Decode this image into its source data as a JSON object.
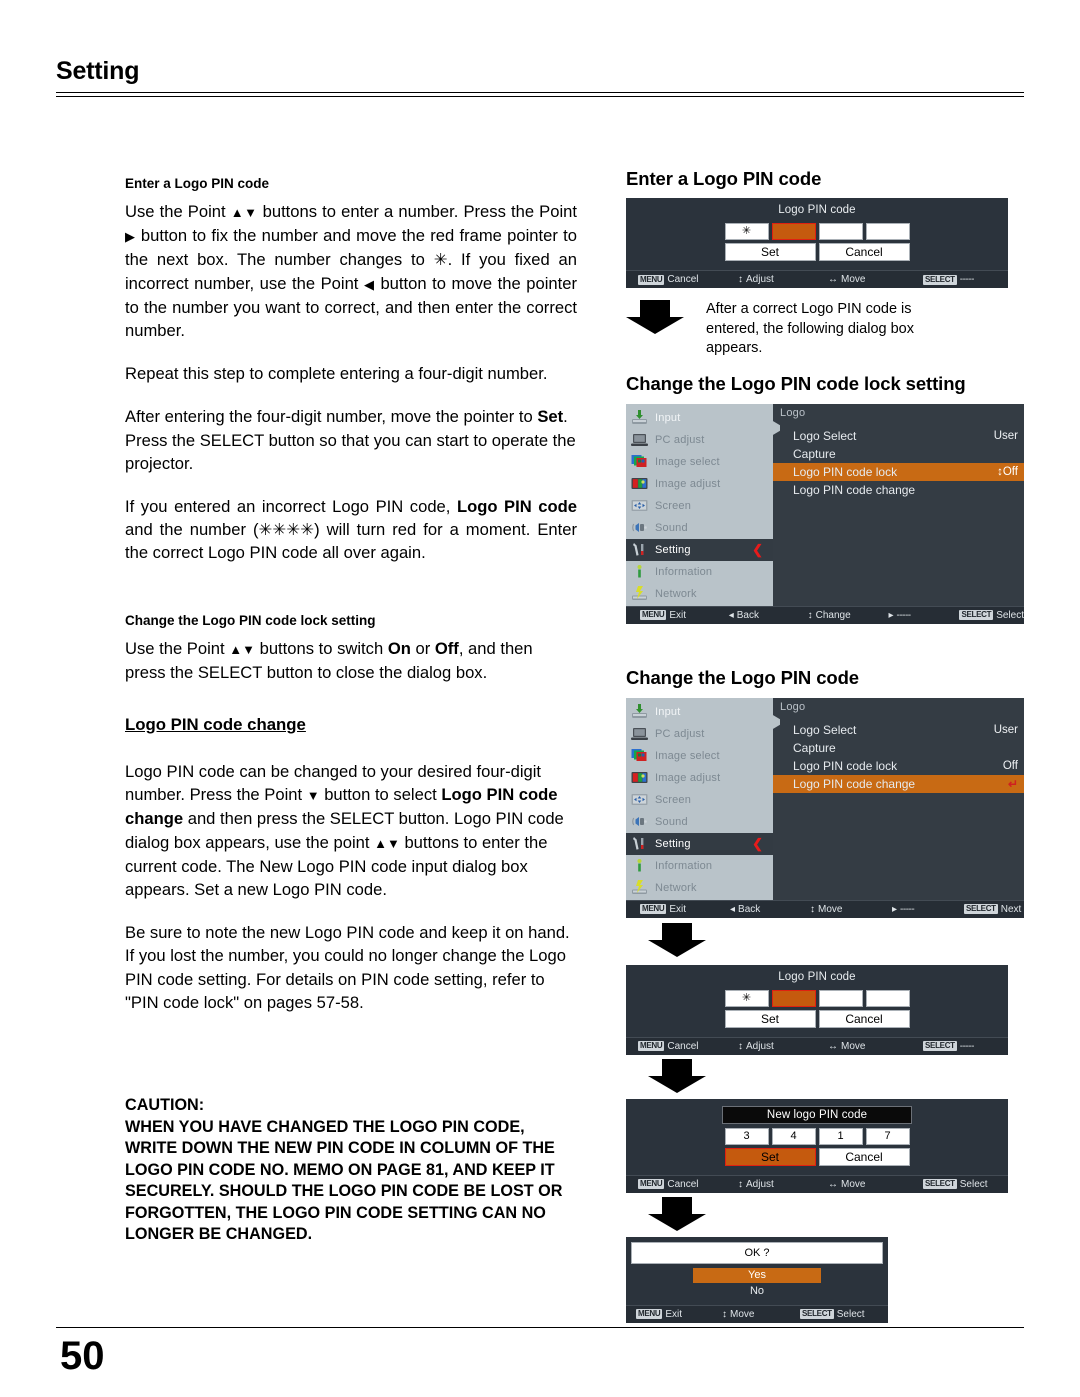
{
  "header": {
    "chapter": "Setting"
  },
  "footer": {
    "page_number": "50"
  },
  "left": {
    "section1_heading": "Enter a Logo PIN code",
    "p1_a": "Use the Point ",
    "p1_up": "▲",
    "p1_dn": "▼",
    "p1_b": " buttons to enter a number. Press the Point ",
    "p1_right": "▶",
    "p1_c": " button to fix the number and move the red frame pointer to the next box. The number changes to ",
    "p1_star": "✳",
    "p1_d": ". If you fixed an incorrect number, use the Point ",
    "p1_left": "◀",
    "p1_e": " button to move the pointer to the number you want to correct, and then enter the correct number.",
    "p2": "Repeat this step to complete entering a four-digit number.",
    "p3_a": "After entering the four-digit number, move the pointer to ",
    "p3_set": "Set",
    "p3_b": ". Press the SELECT button so that you can start to operate the projector.",
    "p4_a": "If you entered an incorrect Logo PIN code, ",
    "p4_bold": "Logo PIN code",
    "p4_b": " and the number (",
    "p4_stars": "✳✳✳✳",
    "p4_c": ") will turn red for a moment. Enter the correct Logo PIN code all over again.",
    "section2_heading": "Change the Logo PIN code lock setting",
    "p5_a": "Use the Point ",
    "p5_b": " buttons to switch ",
    "p5_on": "On",
    "p5_or": " or ",
    "p5_off": "Off",
    "p5_c": ", and then press the SELECT button to close the dialog box.",
    "section3_heading": "Logo PIN code change",
    "p6_a": "Logo PIN code can be changed to your desired four-digit number. Press the Point ",
    "p6_dn": "▼",
    "p6_b": " button to select ",
    "p6_bold": "Logo PIN code change",
    "p6_c": " and then press the SELECT button. Logo PIN code dialog box appears, use the point ",
    "p6_d": " buttons to enter the current code. The New Logo PIN code input dialog box appears. Set a new Logo PIN code.",
    "p7": "Be sure to note the new Logo PIN code and keep it on hand. If you lost the number, you could no longer change the Logo PIN code setting. For details on PIN code setting, refer to \"PIN code lock\" on pages 57-58.",
    "caution_title": "CAUTION:",
    "caution_body": "WHEN YOU HAVE CHANGED THE LOGO PIN CODE, WRITE DOWN THE NEW PIN CODE IN COLUMN OF THE LOGO PIN CODE NO. MEMO ON PAGE 81, AND KEEP IT SECURELY. SHOULD THE LOGO PIN CODE BE LOST OR FORGOTTEN, THE LOGO PIN CODE SETTING CAN NO LONGER BE CHANGED."
  },
  "right": {
    "fig1_heading": "Enter a Logo PIN code",
    "dialog1": {
      "title": "Logo PIN code",
      "digits": [
        "✳",
        "",
        "",
        ""
      ],
      "cursor_index": 1,
      "set_label": "Set",
      "cancel_label": "Cancel",
      "hints": {
        "menu_key": "MENU",
        "menu_action": "Cancel",
        "adjust": "Adjust",
        "move": "Move",
        "select_key": "SELECT",
        "select_action": "-----"
      }
    },
    "note1": "After a correct Logo PIN code is entered, the following dialog box appears.",
    "fig2_heading": "Change the Logo PIN code lock setting",
    "menu1": {
      "panel_title": "Logo",
      "sidebar": [
        {
          "label": "Input",
          "icon": "input-icon"
        },
        {
          "label": "PC adjust",
          "icon": "laptop-icon"
        },
        {
          "label": "Image select",
          "icon": "image-select-icon"
        },
        {
          "label": "Image adjust",
          "icon": "image-adjust-icon"
        },
        {
          "label": "Screen",
          "icon": "screen-icon"
        },
        {
          "label": "Sound",
          "icon": "speaker-icon"
        },
        {
          "label": "Setting",
          "icon": "wrench-icon"
        },
        {
          "label": "Information",
          "icon": "info-icon"
        },
        {
          "label": "Network",
          "icon": "network-icon"
        }
      ],
      "active_index": 6,
      "rows": [
        {
          "label": "Logo Select",
          "value": "User",
          "highlight": false
        },
        {
          "label": "Capture",
          "value": "",
          "highlight": false
        },
        {
          "label": "Logo PIN code lock",
          "value": "↕Off",
          "highlight": true
        },
        {
          "label": "Logo PIN code change",
          "value": "",
          "highlight": false
        }
      ],
      "hints": {
        "menu_key": "MENU",
        "menu_action": "Exit",
        "back": "Back",
        "change": "Change",
        "right_dashes": "-----",
        "select_key": "SELECT",
        "select_action": "Select"
      }
    },
    "fig3_heading": "Change the Logo PIN code",
    "menu2": {
      "panel_title": "Logo",
      "rows": [
        {
          "label": "Logo Select",
          "value": "User",
          "highlight": false
        },
        {
          "label": "Capture",
          "value": "",
          "highlight": false
        },
        {
          "label": "Logo PIN code lock",
          "value": "Off",
          "highlight": false
        },
        {
          "label": "Logo PIN code change",
          "value": "↵",
          "highlight": true
        }
      ],
      "hints": {
        "menu_key": "MENU",
        "menu_action": "Exit",
        "back": "Back",
        "move": "Move",
        "right_dashes": "-----",
        "select_key": "SELECT",
        "select_action": "Next"
      }
    },
    "dialog2": {
      "title": "Logo PIN code",
      "digits": [
        "✳",
        "",
        "",
        ""
      ],
      "cursor_index": 1,
      "set_label": "Set",
      "cancel_label": "Cancel",
      "hints": {
        "menu_key": "MENU",
        "menu_action": "Cancel",
        "adjust": "Adjust",
        "move": "Move",
        "select_key": "SELECT",
        "select_action": "-----"
      }
    },
    "dialog3": {
      "title": "New logo PIN code",
      "digits": [
        "3",
        "4",
        "1",
        "7"
      ],
      "set_label": "Set",
      "cancel_label": "Cancel",
      "set_selected": true,
      "hints": {
        "menu_key": "MENU",
        "menu_action": "Cancel",
        "adjust": "Adjust",
        "move": "Move",
        "select_key": "SELECT",
        "select_action": "Select"
      }
    },
    "dialog4": {
      "title": "OK ?",
      "yes_label": "Yes",
      "no_label": "No",
      "hints": {
        "menu_key": "MENU",
        "menu_action": "Exit",
        "move": "Move",
        "select_key": "SELECT",
        "select_action": "Select"
      }
    }
  },
  "colors": {
    "osd_bg": "#2b333c",
    "panel_bg": "#343c44",
    "sidebar_bg": "#b9c3c9",
    "highlight_orange": "#c86a14",
    "cursor_orange": "#c55a0e",
    "cursor_border_red": "#e02010",
    "caret_red": "#e81b1b"
  }
}
